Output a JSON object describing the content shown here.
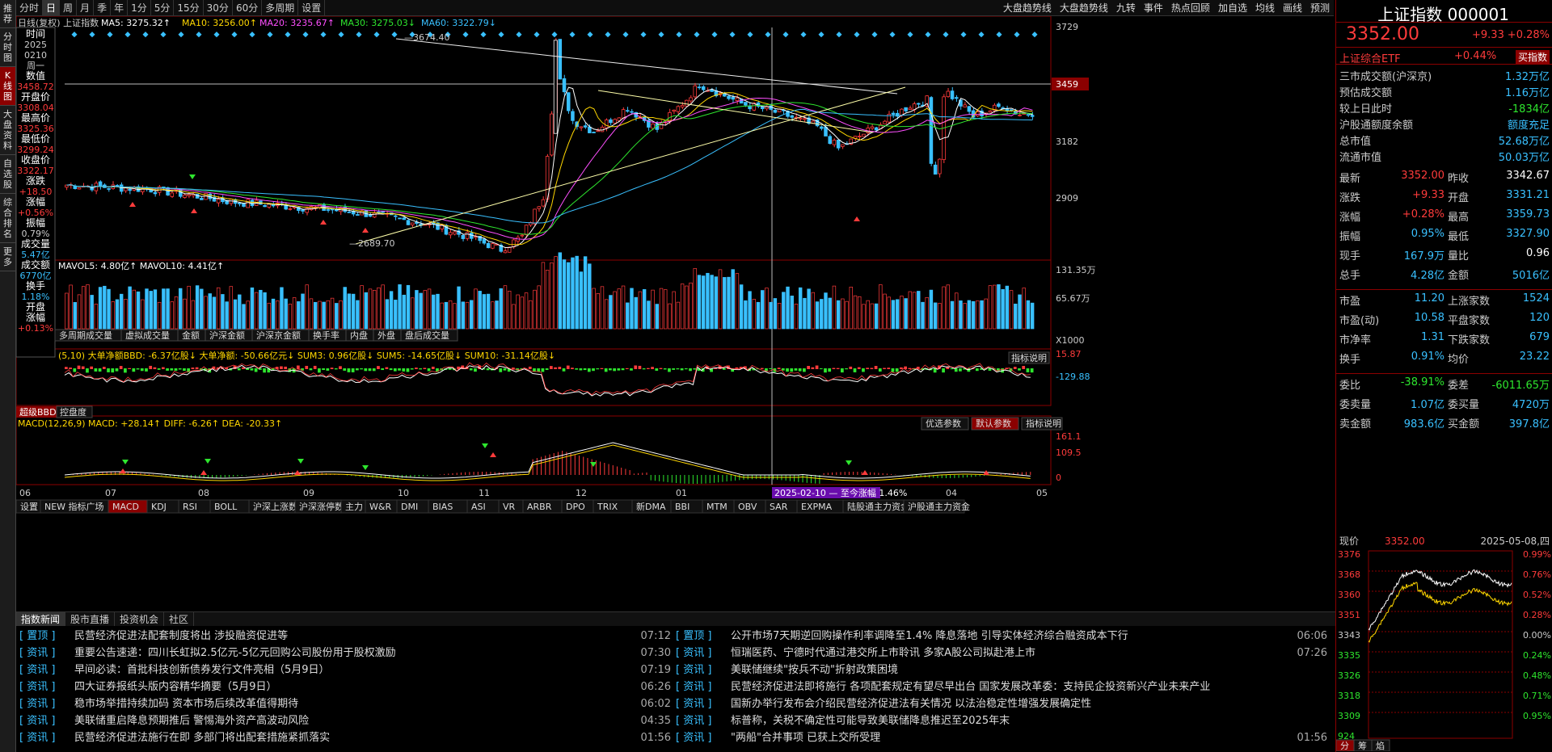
{
  "vside": [
    "推荐",
    "分时图",
    "K线图",
    "大盘资料",
    "自选股",
    "综合排名",
    "更多"
  ],
  "toolbar": {
    "items": [
      "分时",
      "日",
      "周",
      "月",
      "季",
      "年",
      "1分",
      "5分",
      "15分",
      "30分",
      "60分",
      "多周期",
      "设置"
    ],
    "right": [
      "大盘趋势线",
      "大盘趋势线",
      "九转",
      "事件",
      "热点回顾",
      "加自选",
      "均线",
      "画线",
      "预测"
    ]
  },
  "chart_header": {
    "title": "日线(复权) 上证指数",
    "ma5": "MA5: 3275.32↑",
    "ma10": "MA10: 3256.00↑",
    "ma20": "MA20: 3235.67↑",
    "ma30": "MA30: 3275.03↓",
    "ma60": "MA60: 3322.79↓"
  },
  "info_panel": [
    {
      "k": "时间",
      "v": "2025"
    },
    {
      "k": "",
      "v": "0210"
    },
    {
      "k": "",
      "v": "周一"
    },
    {
      "k": "数值",
      "v": "3458.72"
    },
    {
      "k": "开盘价",
      "v": "3308.04"
    },
    {
      "k": "最高价",
      "v": "3325.36"
    },
    {
      "k": "最低价",
      "v": "3299.24"
    },
    {
      "k": "收盘价",
      "v": "3322.17"
    },
    {
      "k": "涨跌",
      "v": "+18.50"
    },
    {
      "k": "涨幅",
      "v": "+0.56%"
    },
    {
      "k": "振幅",
      "v": "0.79%"
    },
    {
      "k": "成交量",
      "v": "5.47亿"
    },
    {
      "k": "成交额",
      "v": "6770亿"
    },
    {
      "k": "换手",
      "v": "1.18%"
    },
    {
      "k": "开盘",
      "v": ""
    },
    {
      "k": "涨幅",
      "v": "+0.13%"
    }
  ],
  "price_axis": [
    "3729",
    "3459",
    "3182",
    "2909"
  ],
  "high_label": "3674.40",
  "low_label": "2689.70",
  "vol_header": "MAVOL5: 4.80亿↑  MAVOL10: 4.41亿↑",
  "vol_axis": [
    "131.35万",
    "65.67万",
    "X1000"
  ],
  "vol_tabs": [
    "多周期成交量",
    "虚拟成交量",
    "金额",
    "沪深金额",
    "沪深京金额",
    "换手率",
    "内盘",
    "外盘",
    "盘后成交量"
  ],
  "bbd_header": "(5,10) 大单净额BBD: -6.37亿股↓ 大单净额: -50.66亿元↓ SUM3: 0.96亿股↓ SUM5: -14.65亿股↓ SUM10: -31.14亿股↓",
  "bbd_axis": [
    "15.87",
    "-129.88"
  ],
  "bbd_tabs": [
    "超级BBD",
    "控盘度"
  ],
  "indicator_btn": "指标说明",
  "macd_header": "MACD(12,26,9) MACD: +28.14↑ DIFF: -6.26↑ DEA: -20.33↑",
  "macd_btns": [
    "优选参数",
    "默认参数",
    "指标说明"
  ],
  "macd_axis": [
    "161.1",
    "109.5",
    "0"
  ],
  "months": [
    "06",
    "07",
    "08",
    "09",
    "10",
    "11",
    "12",
    "01",
    "02",
    "03",
    "04",
    "05"
  ],
  "range_label": "2025-02-10 — 至今涨幅 1.46%",
  "indicator_tabs": [
    "设置",
    "NEW 指标广场",
    "MACD",
    "KDJ",
    "RSI",
    "BOLL",
    "沪深上涨数",
    "沪深涨停数",
    "主力",
    "W&R",
    "DMI",
    "BIAS",
    "ASI",
    "VR",
    "ARBR",
    "DPO",
    "TRIX",
    "新DMA",
    "BBI",
    "MTM",
    "OBV",
    "SAR",
    "EXPMA",
    "陆股通主力资金",
    "沪股通主力资金"
  ],
  "news_tabs": [
    "指数新闻",
    "股市直播",
    "投资机会",
    "社区"
  ],
  "news_left": [
    {
      "tag": "[ 置顶 ]",
      "t": "民营经济促进法配套制度将出 涉投融资促进等",
      "tm": "07:12"
    },
    {
      "tag": "[ 资讯 ]",
      "t": "重要公告速递：四川长虹拟2.5亿元-5亿元回购公司股份用于股权激励",
      "tm": "07:30"
    },
    {
      "tag": "[ 资讯 ]",
      "t": "早间必读：首批科技创新债券发行文件亮相（5月9日）",
      "tm": "07:19"
    },
    {
      "tag": "[ 资讯 ]",
      "t": "四大证券报纸头版内容精华摘要（5月9日）",
      "tm": "06:26"
    },
    {
      "tag": "[ 资讯 ]",
      "t": "稳市场举措持续加码 资本市场后续改革值得期待",
      "tm": "06:02"
    },
    {
      "tag": "[ 资讯 ]",
      "t": "美联储重启降息预期推后 警惕海外资产高波动风险",
      "tm": "04:35"
    },
    {
      "tag": "[ 资讯 ]",
      "t": "民营经济促进法施行在即 多部门将出配套措施紧抓落实",
      "tm": "01:56"
    }
  ],
  "news_right": [
    {
      "tag": "[ 置顶 ]",
      "t": "公开市场7天期逆回购操作利率调降至1.4% 降息落地 引导实体经济综合融资成本下行",
      "tm": "06:06"
    },
    {
      "tag": "[ 资讯 ]",
      "t": "恒瑞医药、宁德时代通过港交所上市聆讯 多家A股公司拟赴港上市",
      "tm": "07:26"
    },
    {
      "tag": "[ 资讯 ]",
      "t": "美联储继续\"按兵不动\"折射政策困境",
      "tm": ""
    },
    {
      "tag": "[ 资讯 ]",
      "t": "民营经济促进法即将施行 各项配套规定有望尽早出台 国家发展改革委：支持民企投资新兴产业未来产业",
      "tm": ""
    },
    {
      "tag": "[ 资讯 ]",
      "t": "国新办举行发布会介绍民营经济促进法有关情况 以法治稳定性增强发展确定性",
      "tm": ""
    },
    {
      "tag": "[ 资讯 ]",
      "t": "标普称，关税不确定性可能导致美联储降息推迟至2025年末",
      "tm": ""
    },
    {
      "tag": "[ 资讯 ]",
      "t": "\"两船\"合并事项 已获上交所受理",
      "tm": "01:56"
    }
  ],
  "quote": {
    "name": "上证指数 000001",
    "price": "3352.00",
    "chg": "+9.33",
    "pct": "+0.28%",
    "etf": "上证综合ETF",
    "etf_pct": "+0.44%",
    "etf_btn": "买指数"
  },
  "stats1": [
    [
      "三市成交额(沪深京)",
      "1.32万亿"
    ],
    [
      "预估成交额",
      "1.16万亿"
    ],
    [
      "较上日此时",
      "-1834亿"
    ],
    [
      "沪股通额度余额",
      "额度充足"
    ],
    [
      "总市值",
      "52.68万亿"
    ],
    [
      "流通市值",
      "50.03万亿"
    ]
  ],
  "stats2": [
    [
      "最新",
      "3352.00",
      "昨收",
      "3342.67"
    ],
    [
      "涨跌",
      "+9.33",
      "开盘",
      "3331.21"
    ],
    [
      "涨幅",
      "+0.28%",
      "最高",
      "3359.73"
    ],
    [
      "振幅",
      "0.95%",
      "最低",
      "3327.90"
    ],
    [
      "现手",
      "167.9万",
      "量比",
      "0.96"
    ],
    [
      "总手",
      "4.28亿",
      "金额",
      "5016亿"
    ]
  ],
  "stats3": [
    [
      "市盈",
      "11.20",
      "上涨家数",
      "1524"
    ],
    [
      "市盈(动)",
      "10.58",
      "平盘家数",
      "120"
    ],
    [
      "市净率",
      "1.31",
      "下跌家数",
      "679"
    ],
    [
      "换手",
      "0.91%",
      "均价",
      "23.22"
    ]
  ],
  "stats4": [
    [
      "委比",
      "-38.91%",
      "委差",
      "-6011.65万"
    ],
    [
      "委卖量",
      "1.07亿",
      "委买量",
      "4720万"
    ],
    [
      "卖金额",
      "983.6亿",
      "买金额",
      "397.8亿"
    ]
  ],
  "intraday": {
    "label": "现价",
    "price": "3352.00",
    "date": "2025-05-08,四",
    "ylabels": [
      "3376",
      "3368",
      "3360",
      "3351",
      "3343",
      "3335",
      "3326",
      "3318",
      "3309",
      "924"
    ],
    "pct": [
      "0.99%",
      "0.76%",
      "0.52%",
      "0.28%",
      "0.00%",
      "0.24%",
      "0.48%",
      "0.71%",
      "0.95%"
    ],
    "tabs": [
      "分",
      "筹",
      "焰"
    ]
  },
  "chart_data": {
    "type": "candlestick",
    "series_note": "上证指数 daily",
    "high": 3674.4,
    "low": 2689.7,
    "last": 3352.0
  }
}
